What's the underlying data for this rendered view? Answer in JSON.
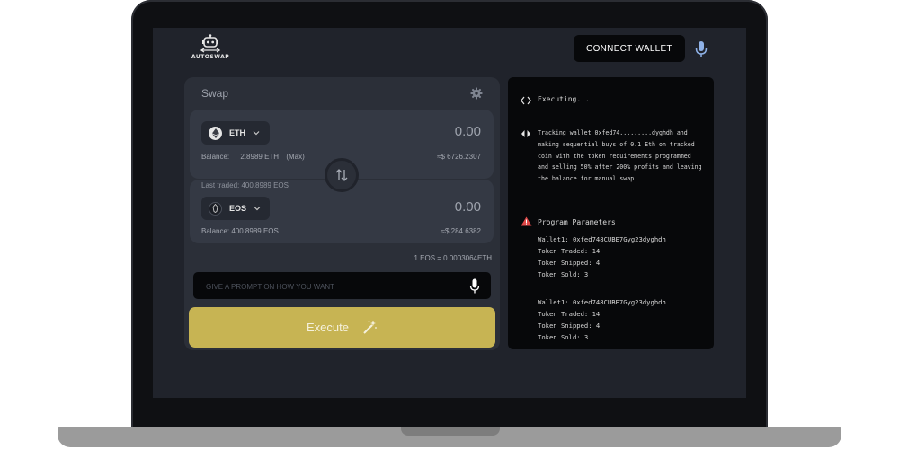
{
  "app": {
    "logo_text": "AUTOSWAP",
    "connect_label": "CONNECT WALLET"
  },
  "swap": {
    "title": "Swap",
    "from": {
      "token": "ETH",
      "amount": "0.00",
      "balance_label": "Balance:",
      "balance_value": "2.8989 ETH",
      "max_label": "(Max)",
      "usd": "≈$ 6726.2307"
    },
    "to": {
      "last_traded": "Last traded:  400.8989 EOS",
      "token": "EOS",
      "amount": "0.00",
      "balance": "Balance:  400.8989 EOS",
      "usd": "≈$ 284.6382"
    },
    "rate": "1 EOS = 0.0003064ETH",
    "prompt_placeholder": "GIVE A PROMPT ON HOW YOU WANT",
    "execute_label": "Execute"
  },
  "console": {
    "status": "Executing...",
    "message": "Tracking wallet 0xfed74.........dyghdh and making sequential buys of 0.1 Eth on tracked coin with the token requirements programmed and selling 50% after 200% profits and leaving the balance for manual swap",
    "params_title": "Program Parameters",
    "parameters": [
      {
        "wallet": "Wallet1: 0xfed748CUBE7Gyg23dyghdh",
        "traded": "Token Traded: 14",
        "snipped": "Token Snipped: 4",
        "sold": "Token Sold: 3"
      },
      {
        "wallet": "Wallet1: 0xfed748CUBE7Gyg23dyghdh",
        "traded": "Token Traded: 14",
        "snipped": "Token Snipped: 4",
        "sold": "Token Sold: 3"
      }
    ]
  },
  "colors": {
    "accent": "#c7b453",
    "panel": "#2b2f38",
    "screen_bg": "#20232b",
    "warning": "#e04848"
  },
  "icons": [
    "robot-logo-icon",
    "microphone-icon",
    "gear-icon",
    "ethereum-icon",
    "eos-icon",
    "chevron-down-icon",
    "swap-arrows-icon",
    "magic-wand-icon",
    "code-icon",
    "warning-icon"
  ]
}
